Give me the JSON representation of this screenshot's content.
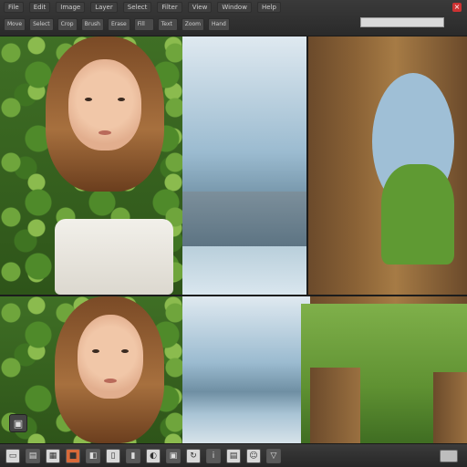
{
  "topbar": {
    "menu": [
      "File",
      "Edit",
      "Image",
      "Layer",
      "Select",
      "Filter",
      "View",
      "Window",
      "Help"
    ],
    "tools": [
      "Move",
      "Select",
      "Crop",
      "Brush",
      "Erase",
      "Fill",
      "Text",
      "Zoom",
      "Hand"
    ]
  },
  "bottombar": {
    "icons": [
      "image-icon",
      "folder-icon",
      "layers-icon",
      "color-icon",
      "mask-icon",
      "copy-icon",
      "paste-icon",
      "adjust-icon",
      "layer-group-icon",
      "refresh-icon",
      "info-icon",
      "doc-icon",
      "profile-icon",
      "filter-icon"
    ]
  }
}
